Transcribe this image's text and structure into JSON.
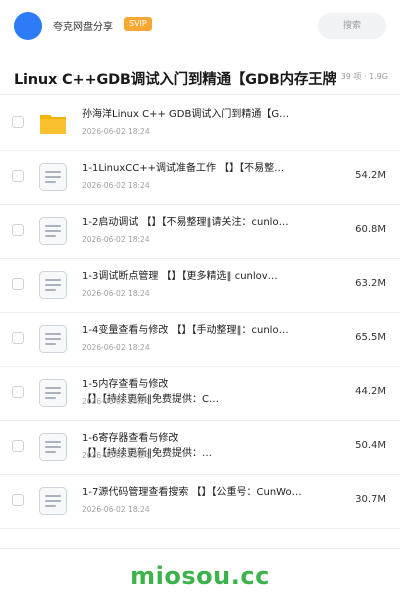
{
  "header": {
    "username": "夸克网盘分享",
    "badge": "SVIP",
    "search_placeholder": "搜索"
  },
  "page": {
    "title": "Linux C++GDB调试入门到精通【GDB内存王牌】",
    "meta": "39 项 · 1.9G"
  },
  "files": [
    {
      "icon": "folder-icon",
      "name_line1": "孙海洋Linux C++ GDB调试入门到精通【G…",
      "name_line2": "",
      "date": "2026-06-02 18:24",
      "size": ""
    },
    {
      "icon": "document-icon",
      "name_line1": "1-1LinuxCC++调试准备工作 【】【不易整…",
      "name_line2": "",
      "date": "2026-06-02 18:24",
      "size": "54.2M"
    },
    {
      "icon": "document-icon",
      "name_line1": "1-2启动调试 【】【不易整理‖请关注：cunlo…",
      "name_line2": "",
      "date": "2026-06-02 18:24",
      "size": "60.8M"
    },
    {
      "icon": "document-icon",
      "name_line1": "1-3调试断点管理 【】【更多精选‖ cunlov…",
      "name_line2": "",
      "date": "2026-06-02 18:24",
      "size": "63.2M"
    },
    {
      "icon": "document-icon",
      "name_line1": "1-4变量查看与修改 【】【手动整理‖：cunlo…",
      "name_line2": "",
      "date": "2026-06-02 18:24",
      "size": "65.5M"
    },
    {
      "icon": "document-icon",
      "name_line1": "1-5内存查看与修改",
      "name_line2": "【】【持续更新‖免费提供：C…",
      "date": "2026-06-02 18:24",
      "size": "44.2M"
    },
    {
      "icon": "document-icon",
      "name_line1": "1-6寄存器查看与修改",
      "name_line2": "【】【持续更新‖免费提供：…",
      "date": "2026-06-02 18:24",
      "size": "50.4M"
    },
    {
      "icon": "document-icon",
      "name_line1": "1-7源代码管理查看搜索 【】【公重号：CunWo…",
      "name_line2": "",
      "date": "2026-06-02 18:24",
      "size": "30.7M"
    }
  ],
  "watermark": "miosou.cc",
  "colors": {
    "accent": "#2b7cf6",
    "svip": "#f7a733",
    "folder": "#fbc02d",
    "watermark": "#3cb24a"
  }
}
